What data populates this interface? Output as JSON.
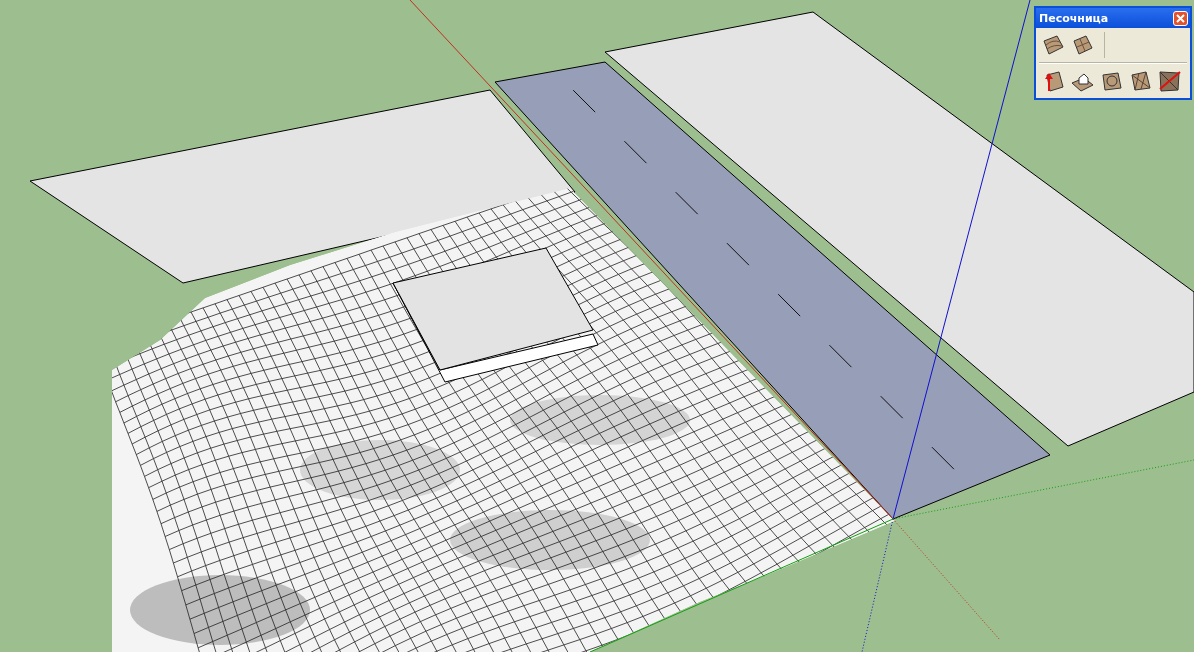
{
  "toolbar": {
    "title": "Песочница"
  }
}
